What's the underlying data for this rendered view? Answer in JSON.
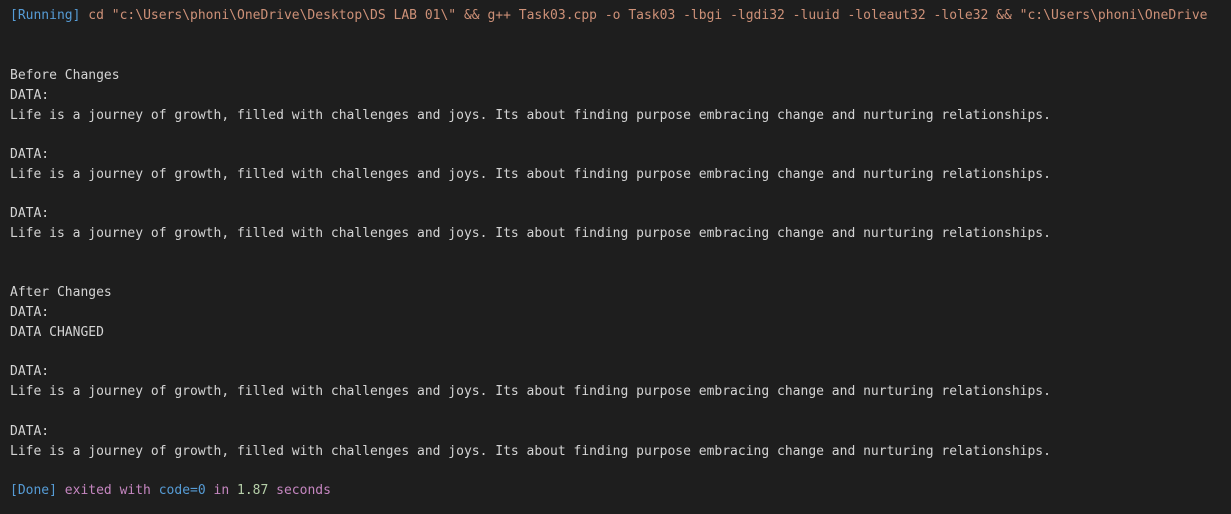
{
  "command_line": {
    "running_tag": "[Running]",
    "command": " cd \"c:\\Users\\phoni\\OneDrive\\Desktop\\DS LAB 01\\\" && g++ Task03.cpp -o Task03 -lbgi -lgdi32 -luuid -loleaut32 -lole32 && \"c:\\Users\\phoni\\OneDrive"
  },
  "output": {
    "before_header": "Before Changes",
    "data_label": "DATA:",
    "sentence": "Life is a journey of growth, filled with challenges and joys. Its about finding purpose embracing change and nurturing relationships.",
    "after_header": "After Changes",
    "changed_text": "DATA CHANGED"
  },
  "footer": {
    "done_tag": "[Done]",
    "exited_with": " exited with ",
    "code_label": "code=0",
    "in_word": " in ",
    "seconds_value": "1.87",
    "seconds_word": " seconds"
  }
}
